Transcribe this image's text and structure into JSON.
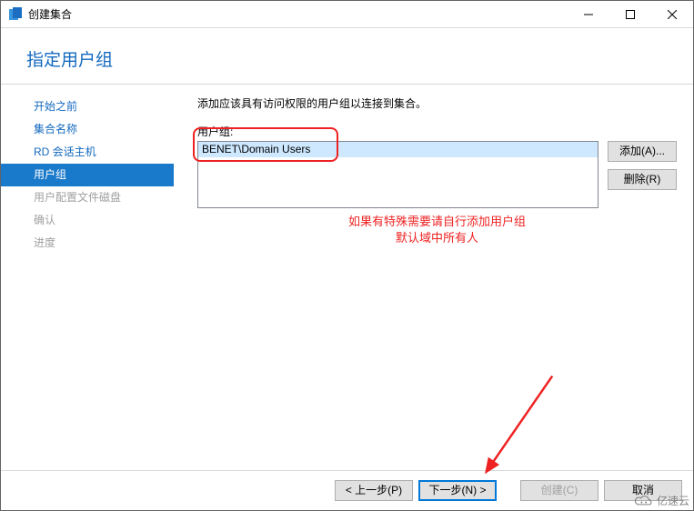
{
  "window": {
    "title": "创建集合"
  },
  "header": {
    "title": "指定用户组"
  },
  "sidebar": {
    "items": [
      {
        "label": "开始之前",
        "state": "past"
      },
      {
        "label": "集合名称",
        "state": "past"
      },
      {
        "label": "RD 会话主机",
        "state": "past"
      },
      {
        "label": "用户组",
        "state": "active"
      },
      {
        "label": "用户配置文件磁盘",
        "state": "future"
      },
      {
        "label": "确认",
        "state": "future"
      },
      {
        "label": "进度",
        "state": "future"
      }
    ]
  },
  "main": {
    "instruction": "添加应该具有访问权限的用户组以连接到集合。",
    "field_label": "用户组:",
    "list": {
      "items": [
        "BENET\\Domain Users"
      ],
      "selected_index": 0
    },
    "buttons": {
      "add": "添加(A)...",
      "remove": "删除(R)"
    },
    "annotation_line1": "如果有特殊需要请自行添加用户组",
    "annotation_line2": "默认域中所有人"
  },
  "footer": {
    "prev": "< 上一步(P)",
    "next": "下一步(N) >",
    "create": "创建(C)",
    "cancel": "取消"
  },
  "watermark": {
    "text": "亿速云"
  }
}
